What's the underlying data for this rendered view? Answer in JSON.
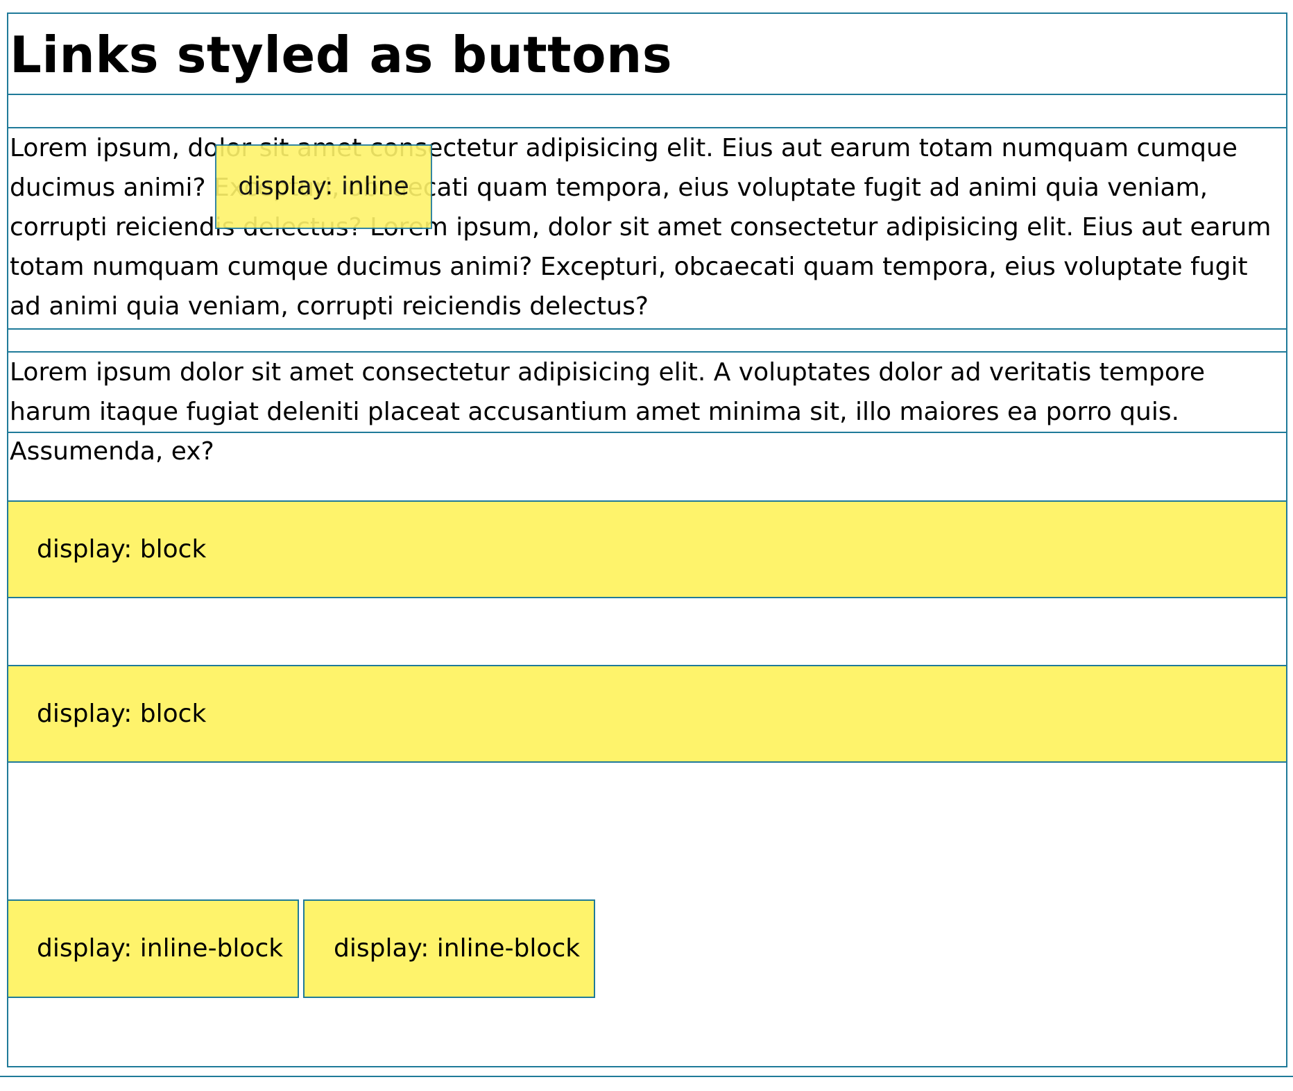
{
  "page": {
    "title": "Links styled as buttons"
  },
  "paragraph1": {
    "text": "Lorem ipsum, dolor sit amet consectetur adipisicing elit. Eius aut earum totam numquam cumque ducimus animi? Excepturi, obcaecati quam tempora, eius voluptate fugit ad animi quia veniam, corrupti reiciendis delectus? Lorem ipsum, dolor sit amet consectetur adipisicing elit. Eius aut earum totam numquam cumque ducimus animi? Excepturi, obcaecati quam tempora, eius voluptate fugit ad animi quia veniam, corrupti reiciendis delectus?",
    "inline_button_label": "display: inline"
  },
  "paragraph2": {
    "text": "Lorem ipsum dolor sit amet consectetur adipisicing elit. A voluptates dolor ad veritatis tempore harum itaque fugiat deleniti placeat accusantium amet minima sit, illo maiores ea porro quis. Assumenda, ex?"
  },
  "block_buttons": [
    {
      "label": "display: block"
    },
    {
      "label": "display: block"
    }
  ],
  "inline_block_buttons": [
    {
      "label": "display: inline-block"
    },
    {
      "label": "display: inline-block"
    }
  ],
  "colors": {
    "button_background": "#fef36b",
    "outline": "#1f7a99",
    "text": "#000000",
    "background": "#ffffff"
  }
}
